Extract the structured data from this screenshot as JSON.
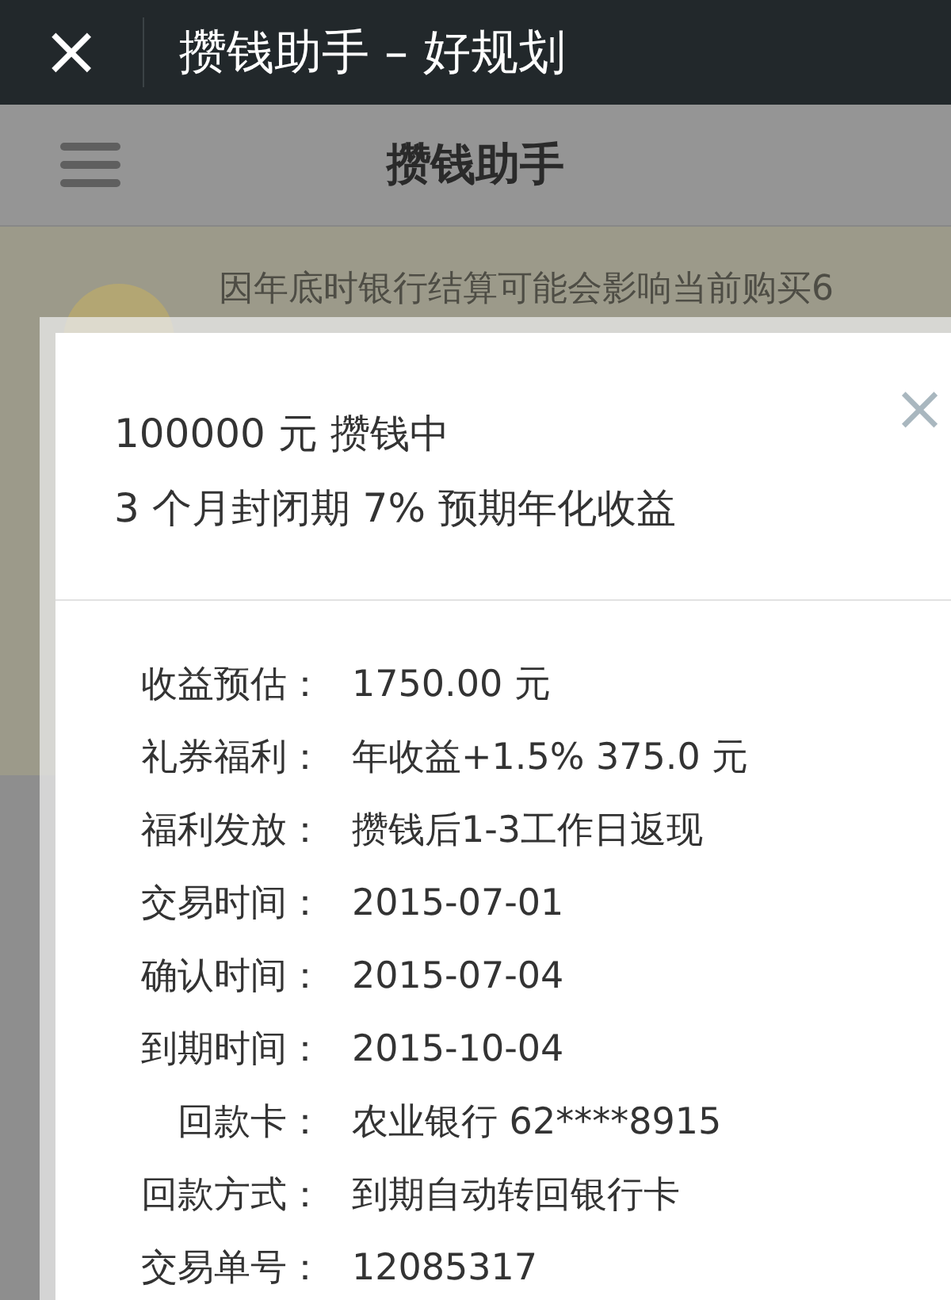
{
  "window": {
    "close": "×",
    "title": "攒钱助手 – 好规划"
  },
  "header": {
    "title": "攒钱助手"
  },
  "notice": {
    "text": "因年底时银行结算可能会影响当前购买6"
  },
  "dialog": {
    "title_lines": [
      "100000 元 攒钱中",
      "3 个月封闭期 7% 预期年化收益"
    ],
    "close": "×",
    "rows": [
      {
        "label": "收益预估：",
        "value": "1750.00 元"
      },
      {
        "label": "礼券福利：",
        "value": "年收益+1.5% 375.0 元"
      },
      {
        "label": "福利发放：",
        "value": "攒钱后1-3工作日返现"
      },
      {
        "label": "交易时间：",
        "value": "2015-07-01"
      },
      {
        "label": "确认时间：",
        "value": "2015-07-04"
      },
      {
        "label": "到期时间：",
        "value": "2015-10-04"
      },
      {
        "label": "回款卡：",
        "value": "农业银行 62****8915"
      },
      {
        "label": "回款方式：",
        "value": "到期自动转回银行卡"
      },
      {
        "label": "交易单号：",
        "value": "12085317"
      }
    ]
  }
}
